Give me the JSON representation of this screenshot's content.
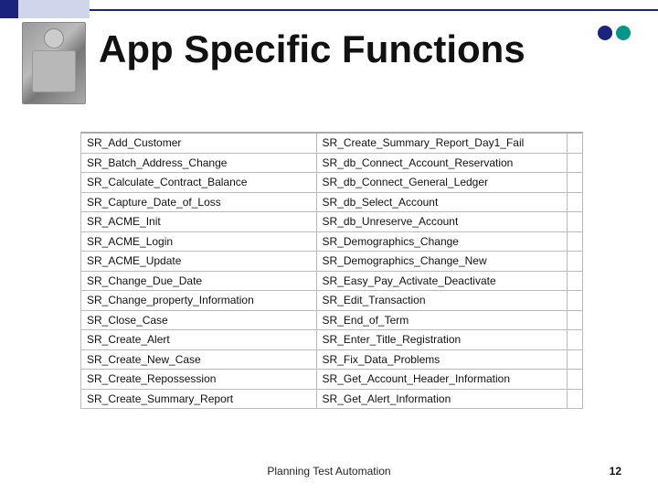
{
  "title": "App Specific Functions",
  "footer": "Planning Test Automation",
  "page_number": "12",
  "functions": {
    "left": [
      "SR_Add_Customer",
      "SR_Batch_Address_Change",
      "SR_Calculate_Contract_Balance",
      "SR_Capture_Date_of_Loss",
      "SR_ACME_Init",
      "SR_ACME_Login",
      "SR_ACME_Update",
      "SR_Change_Due_Date",
      "SR_Change_property_Information",
      "SR_Close_Case",
      "SR_Create_Alert",
      "SR_Create_New_Case",
      "SR_Create_Repossession",
      "SR_Create_Summary_Report"
    ],
    "right": [
      "SR_Create_Summary_Report_Day1_Fail",
      "SR_db_Connect_Account_Reservation",
      "SR_db_Connect_General_Ledger",
      "SR_db_Select_Account",
      "SR_db_Unreserve_Account",
      "SR_Demographics_Change",
      "SR_Demographics_Change_New",
      "SR_Easy_Pay_Activate_Deactivate",
      "SR_Edit_Transaction",
      "SR_End_of_Term",
      "SR_Enter_Title_Registration",
      "SR_Fix_Data_Problems",
      "SR_Get_Account_Header_Information",
      "SR_Get_Alert_Information"
    ]
  }
}
